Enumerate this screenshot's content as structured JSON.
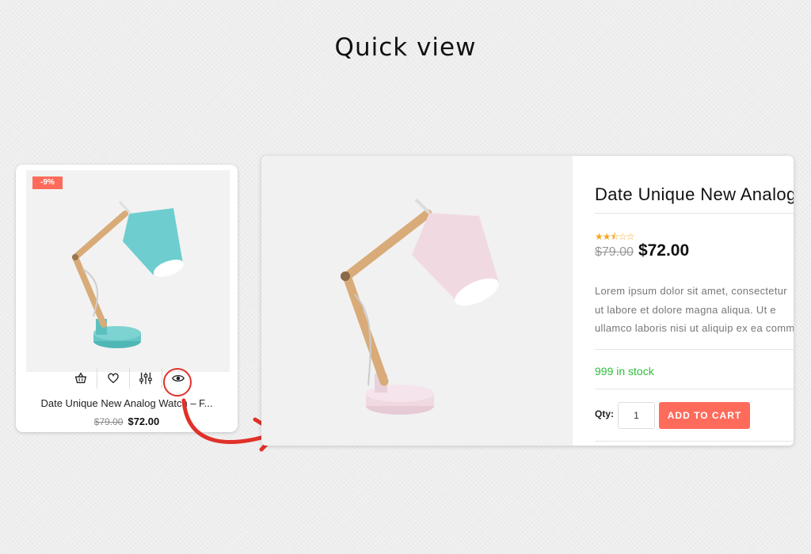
{
  "page": {
    "heading": "Quick view"
  },
  "card": {
    "badge": "-9%",
    "title": "Date Unique New Analog Watch – F...",
    "old_price": "$79.00",
    "price": "$72.00",
    "actions": [
      {
        "name": "add-to-cart-action",
        "icon": "basket-icon"
      },
      {
        "name": "wishlist-action",
        "icon": "heart-icon"
      },
      {
        "name": "compare-action",
        "icon": "sliders-icon"
      },
      {
        "name": "quick-view-action",
        "icon": "eye-icon"
      }
    ],
    "product_color": "#66c7c5"
  },
  "quick_view": {
    "title": "Date Unique New Analog Watch",
    "rating": 2.5,
    "rating_max": 5,
    "old_price": "$79.00",
    "price": "$72.00",
    "description_lines": [
      "Lorem ipsum dolor sit amet, consectetur",
      "ut labore et dolore magna aliqua. Ut e",
      "ullamco laboris nisi ut aliquip ex ea comm"
    ],
    "stock": "999 in stock",
    "qty_label": "Qty:",
    "qty_value": "1",
    "add_to_cart": "ADD TO CART",
    "product_color": "#f1d9e2"
  },
  "colors": {
    "accent": "#ff6b5b",
    "stock": "#2ebd3a",
    "annotation": "#e0312a",
    "star": "#f5a623"
  }
}
